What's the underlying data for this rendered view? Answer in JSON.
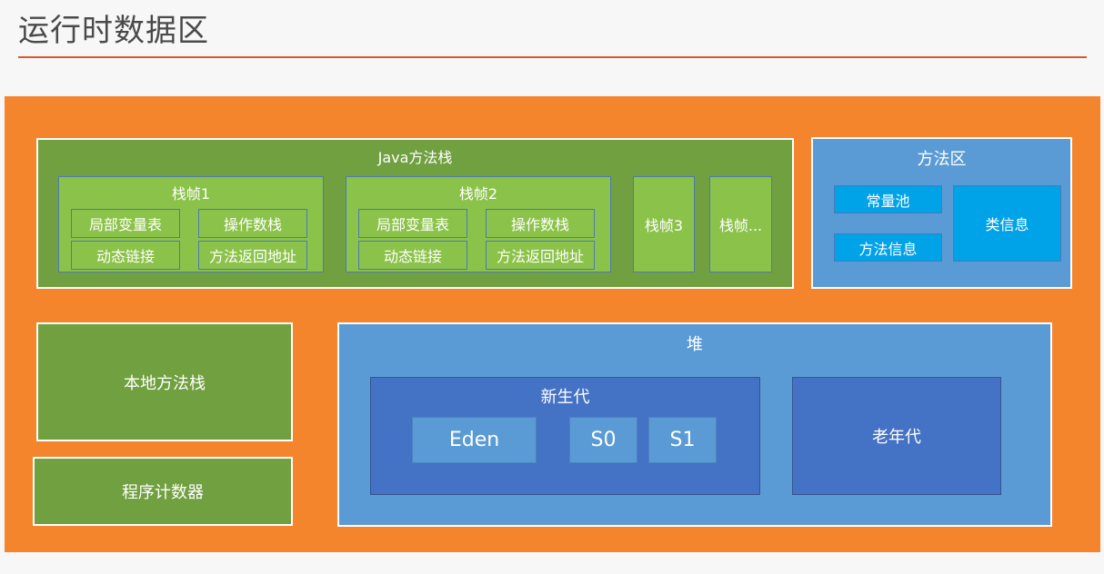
{
  "title": "运行时数据区",
  "java_stack": {
    "label": "Java方法栈",
    "frame1": {
      "label": "栈帧1",
      "cells": [
        "局部变量表",
        "操作数栈",
        "动态链接",
        "方法返回地址"
      ]
    },
    "frame2": {
      "label": "栈帧2",
      "cells": [
        "局部变量表",
        "操作数栈",
        "动态链接",
        "方法返回地址"
      ]
    },
    "frame3": "栈帧3",
    "frame_more": "栈帧..."
  },
  "method_area": {
    "label": "方法区",
    "constant_pool": "常量池",
    "method_info": "方法信息",
    "class_info": "类信息"
  },
  "native_stack": "本地方法栈",
  "pc_register": "程序计数器",
  "heap": {
    "label": "堆",
    "young": {
      "label": "新生代",
      "eden": "Eden",
      "s0": "S0",
      "s1": "S1"
    },
    "old": "老年代"
  },
  "colors": {
    "frame_orange": "#f5852d",
    "green_dark": "#70a040",
    "green_light": "#8bc24a",
    "blue": "#5b9bd5",
    "blue_dark": "#4472c4",
    "cyan": "#00a2e8",
    "title_rule": "#d45a2a"
  }
}
